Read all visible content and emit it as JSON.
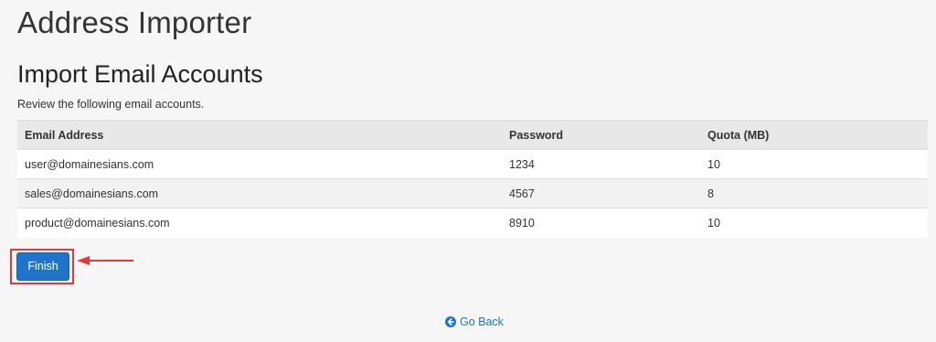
{
  "page": {
    "title": "Address Importer"
  },
  "section": {
    "title": "Import Email Accounts",
    "description": "Review the following email accounts."
  },
  "table": {
    "headers": [
      "Email Address",
      "Password",
      "Quota (MB)"
    ],
    "rows": [
      {
        "email": "user@domainesians.com",
        "password": "1234",
        "quota": "10"
      },
      {
        "email": "sales@domainesians.com",
        "password": "4567",
        "quota": "8"
      },
      {
        "email": "product@domainesians.com",
        "password": "8910",
        "quota": "10"
      }
    ]
  },
  "actions": {
    "finish_label": "Finish",
    "go_back_label": "Go Back",
    "go_back_icon": "arrow-circle-left-icon"
  },
  "colors": {
    "primary": "#1e74c8",
    "highlight": "#e53935",
    "background": "#f6f6f6"
  }
}
